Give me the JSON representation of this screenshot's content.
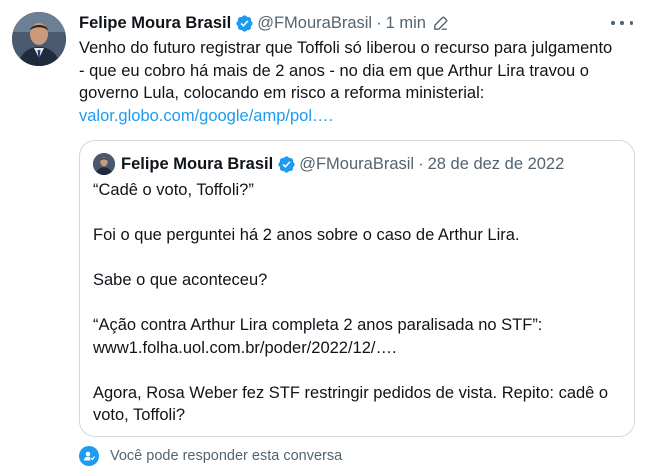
{
  "tweet": {
    "author_name": "Felipe Moura Brasil",
    "handle": "@FMouraBrasil",
    "separator": "·",
    "time": "1 min",
    "text_lines": [
      "Venho do futuro registrar que Toffoli só liberou o recurso para julgamento",
      "- que eu cobro há mais de 2 anos - no dia em que Arthur Lira travou o",
      "governo Lula, colocando em risco a reforma ministerial:"
    ],
    "link_text": "valor.globo.com/google/amp/pol…."
  },
  "quote": {
    "author_name": "Felipe Moura Brasil",
    "handle": "@FMouraBrasil",
    "separator": "·",
    "date": "28 de dez de 2022",
    "line1": "“Cadê o voto, Toffoli?”",
    "line2": "Foi o que perguntei há 2 anos sobre o caso de Arthur Lira.",
    "line3": "Sabe o que aconteceu?",
    "line4": "“Ação contra Arthur Lira completa 2 anos paralisada no STF”:",
    "line5": "www1.folha.uol.com.br/poder/2022/12/….",
    "line6": "Agora, Rosa Weber fez STF restringir pedidos de vista. Repito: cadê o",
    "line7": "voto, Toffoli?"
  },
  "reply_note": "Você pode responder esta conversa",
  "colors": {
    "accent": "#1d9bf0",
    "muted": "#536471",
    "text": "#0f1419",
    "border": "#cfd9de"
  },
  "icons": [
    "verified-badge-icon",
    "edit-icon",
    "more-icon",
    "reply-permission-icon"
  ]
}
